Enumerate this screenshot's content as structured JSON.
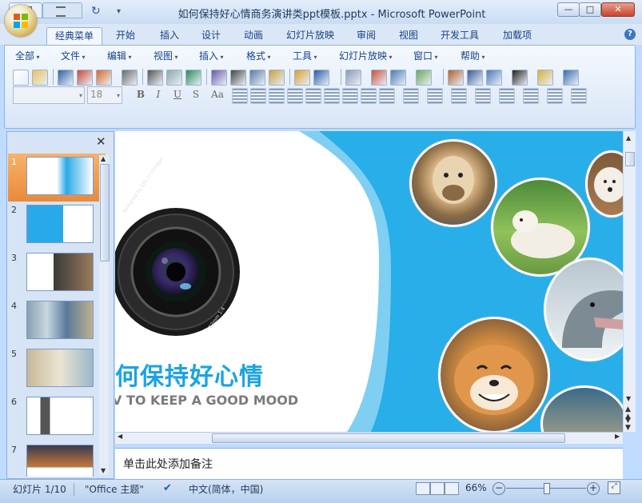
{
  "window": {
    "title": "如何保持好心情商务演讲类ppt模板.pptx - Microsoft PowerPoint",
    "minimize": "—",
    "maximize": "□",
    "close": "✕"
  },
  "ribbon_tabs": [
    "经典菜单",
    "开始",
    "插入",
    "设计",
    "动画",
    "幻灯片放映",
    "审阅",
    "视图",
    "开发工具",
    "加载项"
  ],
  "menu": [
    "全部",
    "文件",
    "编辑",
    "视图",
    "插入",
    "格式",
    "工具",
    "幻灯片放映",
    "窗口",
    "帮助"
  ],
  "format": {
    "font_name": "",
    "font_size": "18",
    "bold": "B",
    "italic": "I",
    "underline": "U",
    "strike": "S",
    "case": "Aa"
  },
  "slides": [
    {
      "num": "1",
      "theme": "title"
    },
    {
      "num": "2",
      "theme": "blue"
    },
    {
      "num": "3",
      "theme": "photo"
    },
    {
      "num": "4",
      "theme": "photos"
    },
    {
      "num": "5",
      "theme": "beige"
    },
    {
      "num": "6",
      "theme": "man"
    },
    {
      "num": "7",
      "theme": "sunset"
    }
  ],
  "slide": {
    "title_cn": "何保持好心情",
    "title_en": "V TO KEEP A GOOD MOOD",
    "lens_ring_text": "Designed by ZIG in Chicago",
    "lens_ring_text2": "52mm 1:4",
    "accent_color": "#2aa9e8"
  },
  "notes_placeholder": "单击此处添加备注",
  "status": {
    "slide_count": "幻灯片 1/10",
    "theme": "\"Office 主题\"",
    "language": "中文(简体，中国)",
    "zoom": "66%",
    "zoom_level": 0.5
  }
}
